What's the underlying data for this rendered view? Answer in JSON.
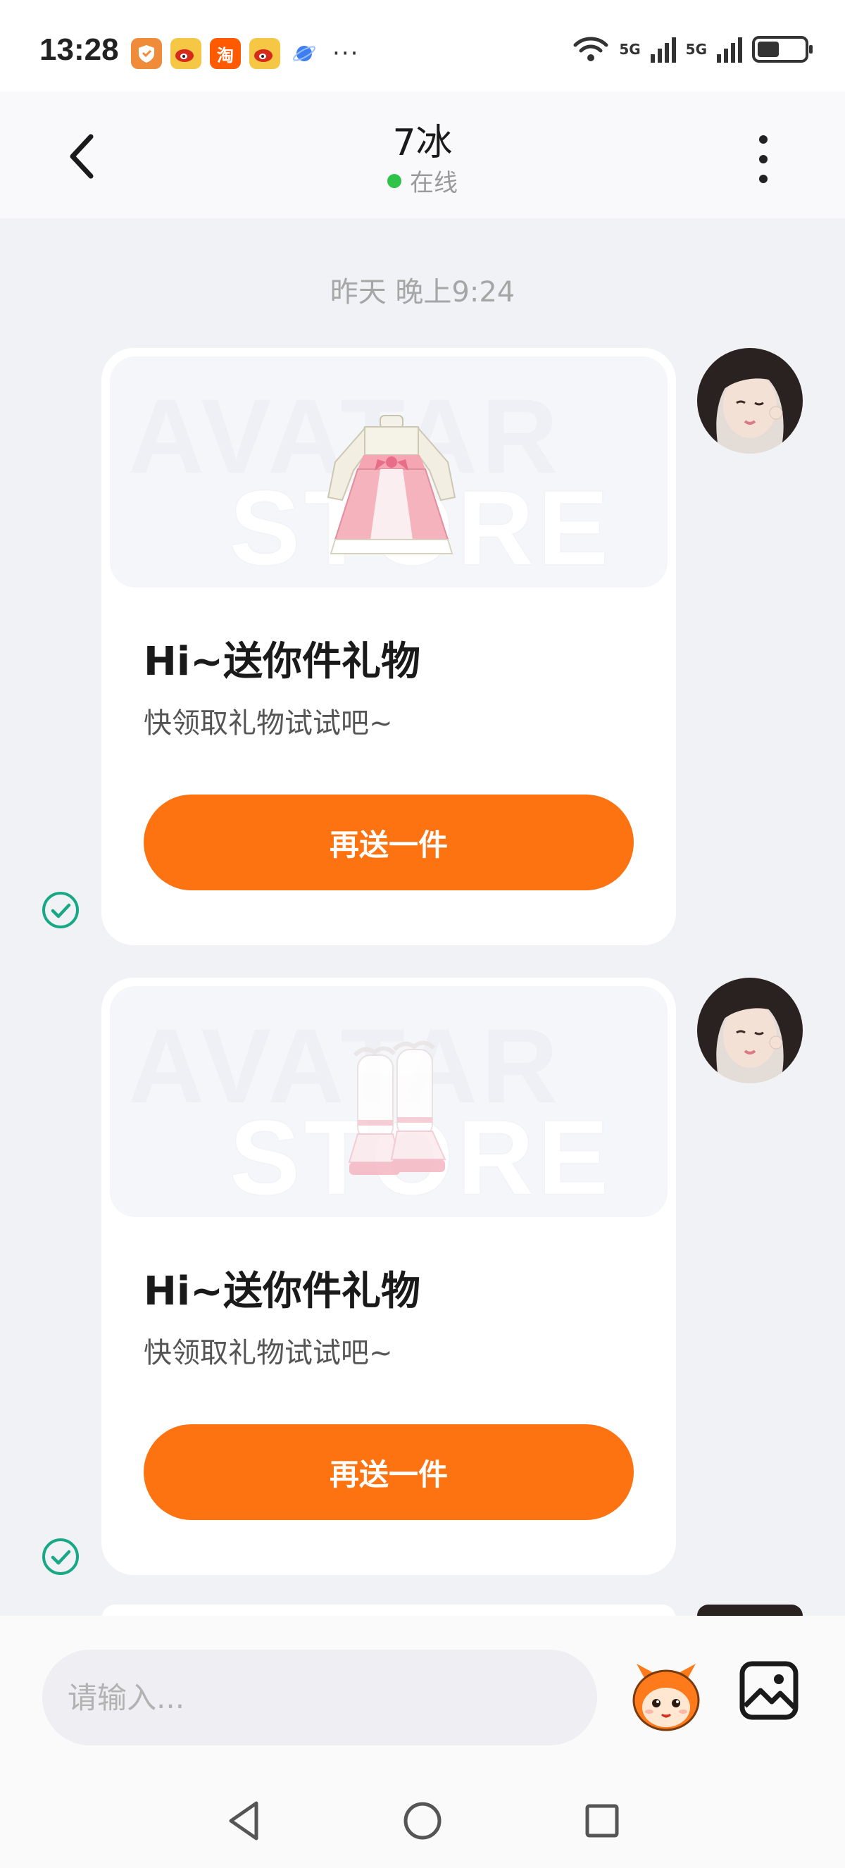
{
  "status_bar": {
    "time": "13:28",
    "app_icons": [
      "shield-icon",
      "weibo-icon",
      "taobao-icon",
      "weibo-icon",
      "planet-icon"
    ],
    "taobao_label": "淘",
    "more": "···",
    "signal_1_label": "5G",
    "signal_2_label": "5G",
    "battery_level": 0.4
  },
  "header": {
    "title": "7冰",
    "status": "在线",
    "online_color": "#2fc34a"
  },
  "chat": {
    "timestamp": "昨天 晚上9:24",
    "messages": [
      {
        "banner_watermark_1": "AVATAR",
        "banner_watermark_2": "STORE",
        "item": "dress",
        "title": "Hi~送你件礼物",
        "subtitle": "快领取礼物试试吧~",
        "button_label": "再送一件",
        "sent": true
      },
      {
        "banner_watermark_1": "AVATAR",
        "banner_watermark_2": "STORE",
        "item": "boots",
        "title": "Hi~送你件礼物",
        "subtitle": "快领取礼物试试吧~",
        "button_label": "再送一件",
        "sent": true
      }
    ]
  },
  "input_bar": {
    "placeholder": "请输入..."
  },
  "colors": {
    "accent": "#fe7311",
    "check": "#19a886",
    "background": "#f1f2f6"
  }
}
